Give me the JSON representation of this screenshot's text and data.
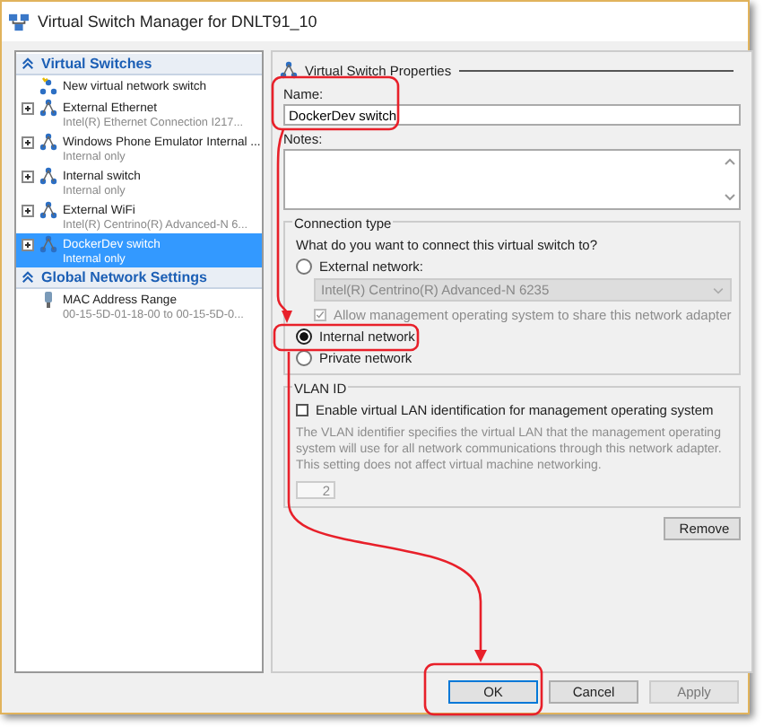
{
  "window": {
    "title": "Virtual Switch Manager for DNLT91_10"
  },
  "sidebar": {
    "sections": [
      {
        "title": "Virtual Switches",
        "items": [
          {
            "kind": "new",
            "name": "New virtual network switch",
            "selected": false
          },
          {
            "kind": "switch",
            "name": "External Ethernet",
            "detail": "Intel(R) Ethernet Connection I217...",
            "selected": false
          },
          {
            "kind": "switch",
            "name": "Windows Phone Emulator Internal ...",
            "detail": "Internal only",
            "selected": false
          },
          {
            "kind": "switch",
            "name": "Internal switch",
            "detail": "Internal only",
            "selected": false
          },
          {
            "kind": "switch",
            "name": "External WiFi",
            "detail": "Intel(R) Centrino(R) Advanced-N 6...",
            "selected": false
          },
          {
            "kind": "switch",
            "name": "DockerDev switch",
            "detail": "Internal only",
            "selected": true
          }
        ]
      },
      {
        "title": "Global Network Settings",
        "items": [
          {
            "kind": "setting",
            "name": "MAC Address Range",
            "detail": "00-15-5D-01-18-00 to 00-15-5D-0...",
            "selected": false
          }
        ]
      }
    ]
  },
  "properties": {
    "title": "Virtual Switch Properties",
    "name_label": "Name:",
    "name_value": "DockerDev switch",
    "notes_label": "Notes:",
    "connection": {
      "legend": "Connection type",
      "question": "What do you want to connect this virtual switch to?",
      "options": [
        {
          "label": "External network:",
          "selected": false
        },
        {
          "label": "Internal network",
          "selected": true
        },
        {
          "label": "Private network",
          "selected": false
        }
      ],
      "adapter": {
        "value": "Intel(R) Centrino(R) Advanced-N 6235",
        "disabled": true
      },
      "share": {
        "label": "Allow management operating system to share this network adapter",
        "checked": true,
        "disabled": true
      }
    },
    "vlan": {
      "legend": "VLAN ID",
      "enable": {
        "label": "Enable virtual LAN identification for management operating system",
        "checked": false
      },
      "description": "The VLAN identifier specifies the virtual LAN that the management operating system will use for all network communications through this network adapter. This setting does not affect virtual machine networking.",
      "value": "2",
      "disabled": true
    },
    "remove_button": "Remove"
  },
  "buttons": [
    {
      "label": "OK",
      "default": true,
      "disabled": false
    },
    {
      "label": "Cancel",
      "default": false,
      "disabled": false
    },
    {
      "label": "Apply",
      "default": false,
      "disabled": true
    }
  ]
}
